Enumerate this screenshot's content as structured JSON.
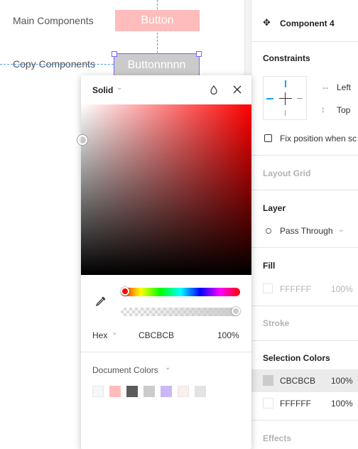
{
  "canvas": {
    "main_components_label": "Main Components",
    "copy_components_label": "Copy Components",
    "main_button_label": "Button",
    "copy_button_label": "Buttonnnnn"
  },
  "panel": {
    "component_title": "Component 4",
    "constraints": {
      "title": "Constraints",
      "horizontal": "Left",
      "vertical": "Top",
      "fix_position_label": "Fix position when sc"
    },
    "layout_grid_title": "Layout Grid",
    "layer": {
      "title": "Layer",
      "blend_mode": "Pass Through"
    },
    "fill": {
      "title": "Fill",
      "hex": "FFFFFF",
      "opacity": "100%"
    },
    "stroke_title": "Stroke",
    "selection_colors": {
      "title": "Selection Colors",
      "items": [
        {
          "hex": "CBCBCB",
          "opacity": "100%",
          "color": "#cbcbcb"
        },
        {
          "hex": "FFFFFF",
          "opacity": "100%",
          "color": "#ffffff"
        }
      ]
    },
    "effects_title": "Effects"
  },
  "color_picker": {
    "paint_type": "Solid",
    "color_model": "Hex",
    "hex_value": "CBCBCB",
    "opacity": "100%",
    "current_color": "#cbcbcb",
    "document_colors_label": "Document Colors",
    "document_colors": [
      "#f7f7f7",
      "#ffbcbc",
      "#5c5c5c",
      "#cbcbcb",
      "#c9b8f5",
      "#fdeded",
      "#e3e3e3"
    ]
  },
  "colors": {
    "accent": "#7b61ff",
    "guide": "#4f9cf5",
    "constraint": "#18a0fb"
  }
}
